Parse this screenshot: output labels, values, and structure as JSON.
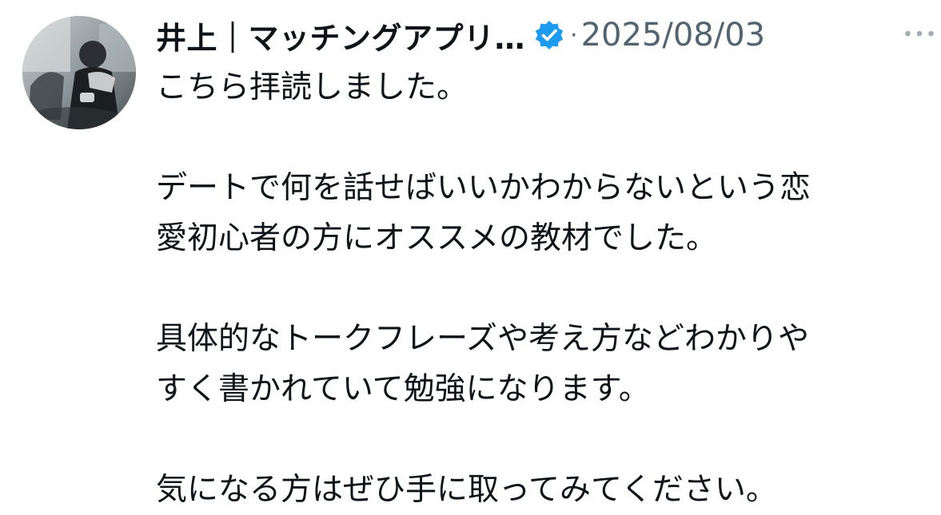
{
  "post": {
    "author": {
      "display_name": "井上｜マッチングアプリ…",
      "verified": true,
      "avatar_icon": "user-avatar-photo",
      "verified_icon": "verified-badge-icon",
      "verified_color": "#1d9bf0"
    },
    "separator": "·",
    "date": "2025/08/03",
    "more_icon": "more-options-icon",
    "body": {
      "paragraphs": [
        {
          "lines": [
            "こちら拝読しました。"
          ]
        },
        {
          "lines": [
            "デートで何を話せばいいかわからないという恋",
            "愛初心者の方にオススメの教材でした。"
          ]
        },
        {
          "lines": [
            "具体的なトークフレーズや考え方などわかりや",
            "すく書かれていて勉強になります。"
          ]
        },
        {
          "lines": [
            "気になる方はぜひ手に取ってみてください。"
          ]
        }
      ]
    }
  },
  "colors": {
    "text_primary": "#0f1419",
    "text_secondary": "#536471",
    "verified": "#1d9bf0"
  }
}
